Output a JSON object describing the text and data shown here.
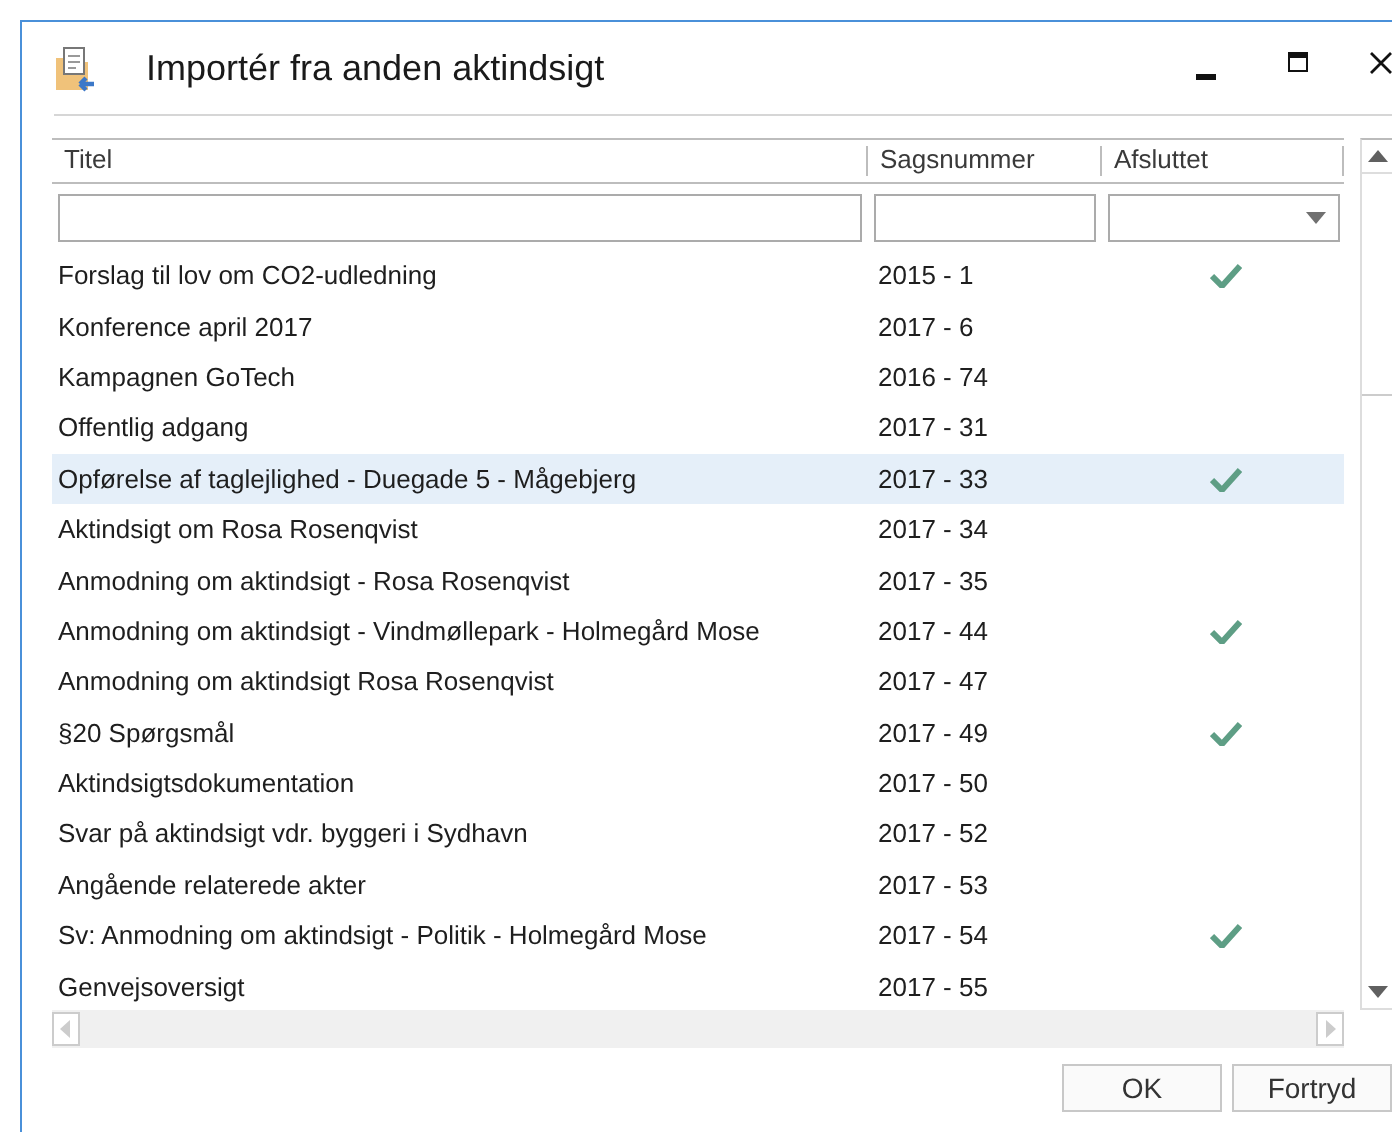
{
  "window": {
    "title": "Importér fra anden aktindsigt"
  },
  "table": {
    "columns": [
      "Titel",
      "Sagsnummer",
      "Afsluttet"
    ],
    "rows": [
      {
        "title": "Forslag til lov om CO2-udledning",
        "case": "2015 - 1",
        "closed": true,
        "selected": false
      },
      {
        "title": "Konference april 2017",
        "case": "2017 - 6",
        "closed": false,
        "selected": false
      },
      {
        "title": "Kampagnen GoTech",
        "case": "2016 - 74",
        "closed": false,
        "selected": false
      },
      {
        "title": "Offentlig adgang",
        "case": "2017 - 31",
        "closed": false,
        "selected": false
      },
      {
        "title": "Opførelse af taglejlighed - Duegade 5 - Mågebjerg",
        "case": "2017 - 33",
        "closed": true,
        "selected": true
      },
      {
        "title": "Aktindsigt om Rosa Rosenqvist",
        "case": "2017 - 34",
        "closed": false,
        "selected": false
      },
      {
        "title": "Anmodning om aktindsigt - Rosa Rosenqvist",
        "case": "2017 - 35",
        "closed": false,
        "selected": false
      },
      {
        "title": "Anmodning om aktindsigt - Vindmøllepark - Holmegård Mose",
        "case": "2017 - 44",
        "closed": true,
        "selected": false
      },
      {
        "title": "Anmodning om aktindsigt Rosa Rosenqvist",
        "case": "2017 - 47",
        "closed": false,
        "selected": false
      },
      {
        "title": "§20 Spørgsmål",
        "case": "2017 - 49",
        "closed": true,
        "selected": false
      },
      {
        "title": "Aktindsigtsdokumentation",
        "case": "2017 - 50",
        "closed": false,
        "selected": false
      },
      {
        "title": "Svar på aktindsigt vdr. byggeri i Sydhavn",
        "case": "2017 - 52",
        "closed": false,
        "selected": false
      },
      {
        "title": "Angående relaterede akter",
        "case": "2017 - 53",
        "closed": false,
        "selected": false
      },
      {
        "title": "Sv: Anmodning om aktindsigt - Politik - Holmegård Mose",
        "case": "2017 - 54",
        "closed": true,
        "selected": false
      },
      {
        "title": "Genvejsoversigt",
        "case": "2017 - 55",
        "closed": false,
        "selected": false
      }
    ]
  },
  "buttons": [
    "OK",
    "Fortryd"
  ]
}
